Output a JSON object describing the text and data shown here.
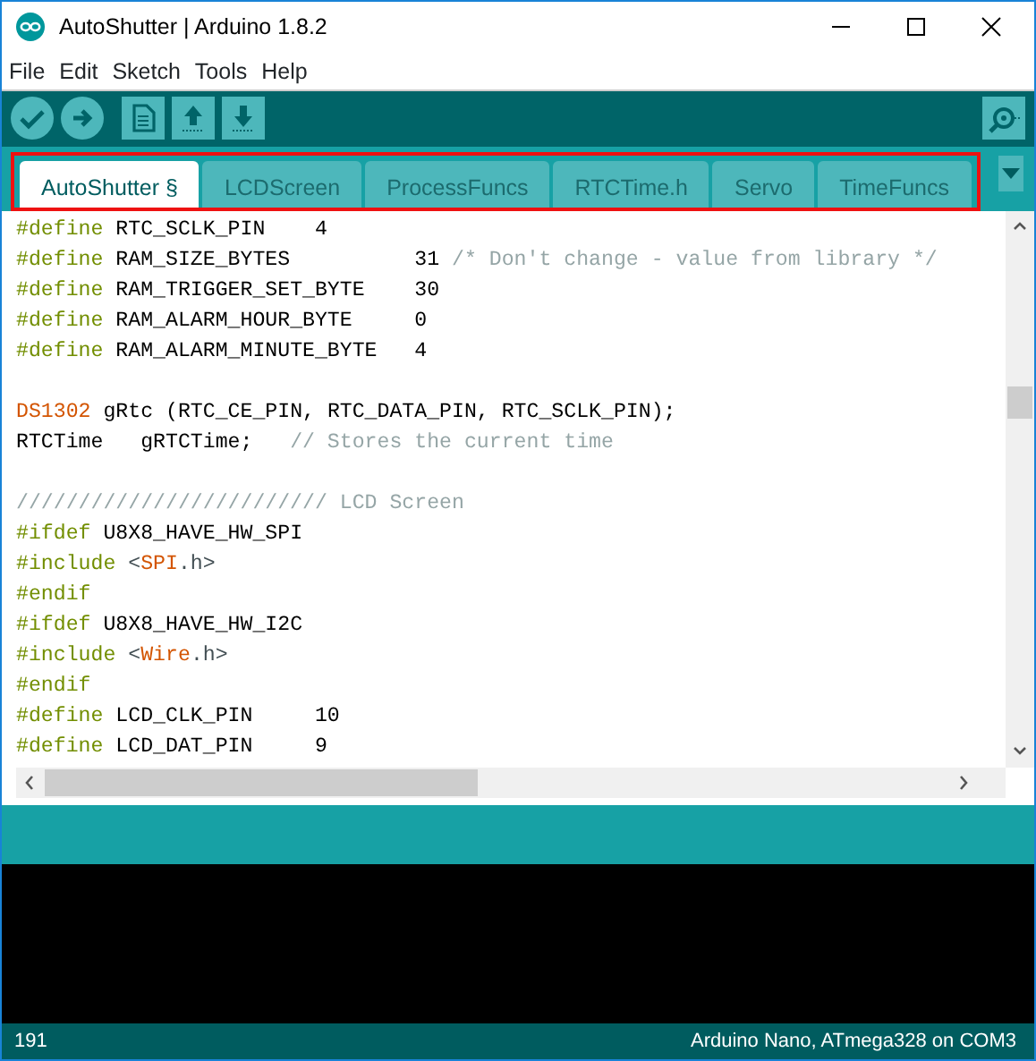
{
  "window": {
    "title": "AutoShutter | Arduino 1.8.2"
  },
  "menu": [
    {
      "label": "File"
    },
    {
      "label": "Edit"
    },
    {
      "label": "Sketch"
    },
    {
      "label": "Tools"
    },
    {
      "label": "Help"
    }
  ],
  "toolbar": [
    {
      "kind": "verify"
    },
    {
      "kind": "upload"
    },
    {
      "kind": "new"
    },
    {
      "kind": "open"
    },
    {
      "kind": "save"
    }
  ],
  "tabs_highlighted": true,
  "tabs": [
    {
      "label": "AutoShutter §",
      "selected": true
    },
    {
      "label": "LCDScreen",
      "selected": false
    },
    {
      "label": "ProcessFuncs",
      "selected": false
    },
    {
      "label": "RTCTime.h",
      "selected": false
    },
    {
      "label": "Servo",
      "selected": false
    },
    {
      "label": "TimeFuncs",
      "selected": false
    }
  ],
  "code": [
    {
      "kind": "code",
      "tokens": [
        {
          "kind": "directive",
          "text": "#define"
        },
        {
          "kind": "plain",
          "text": " RTC_SCLK_PIN    4"
        }
      ]
    },
    {
      "kind": "code",
      "tokens": [
        {
          "kind": "directive",
          "text": "#define"
        },
        {
          "kind": "plain",
          "text": " RAM_SIZE_BYTES          31 "
        },
        {
          "kind": "comment",
          "text": "/* Don't change - value from library */"
        }
      ]
    },
    {
      "kind": "code",
      "tokens": [
        {
          "kind": "directive",
          "text": "#define"
        },
        {
          "kind": "plain",
          "text": " RAM_TRIGGER_SET_BYTE    30"
        }
      ]
    },
    {
      "kind": "code",
      "tokens": [
        {
          "kind": "directive",
          "text": "#define"
        },
        {
          "kind": "plain",
          "text": " RAM_ALARM_HOUR_BYTE     0"
        }
      ]
    },
    {
      "kind": "code",
      "tokens": [
        {
          "kind": "directive",
          "text": "#define"
        },
        {
          "kind": "plain",
          "text": " RAM_ALARM_MINUTE_BYTE   4"
        }
      ]
    },
    {
      "kind": "blank"
    },
    {
      "kind": "code",
      "tokens": [
        {
          "kind": "type",
          "text": "DS1302"
        },
        {
          "kind": "plain",
          "text": " gRtc (RTC_CE_PIN, RTC_DATA_PIN, RTC_SCLK_PIN);"
        }
      ]
    },
    {
      "kind": "code",
      "tokens": [
        {
          "kind": "plain",
          "text": "RTCTime   gRTCTime;   "
        },
        {
          "kind": "comment",
          "text": "// Stores the current time"
        }
      ]
    },
    {
      "kind": "blank"
    },
    {
      "kind": "code",
      "tokens": [
        {
          "kind": "comment",
          "text": "///////////////////////// LCD Screen"
        }
      ]
    },
    {
      "kind": "code",
      "tokens": [
        {
          "kind": "directive",
          "text": "#ifdef"
        },
        {
          "kind": "plain",
          "text": " U8X8_HAVE_HW_SPI"
        }
      ]
    },
    {
      "kind": "code",
      "tokens": [
        {
          "kind": "directive",
          "text": "#include"
        },
        {
          "kind": "punct",
          "text": " <"
        },
        {
          "kind": "type",
          "text": "SPI"
        },
        {
          "kind": "punct",
          "text": ".h>"
        }
      ]
    },
    {
      "kind": "code",
      "tokens": [
        {
          "kind": "directive",
          "text": "#endif"
        }
      ]
    },
    {
      "kind": "code",
      "tokens": [
        {
          "kind": "directive",
          "text": "#ifdef"
        },
        {
          "kind": "plain",
          "text": " U8X8_HAVE_HW_I2C"
        }
      ]
    },
    {
      "kind": "code",
      "tokens": [
        {
          "kind": "directive",
          "text": "#include"
        },
        {
          "kind": "punct",
          "text": " <"
        },
        {
          "kind": "type",
          "text": "Wire"
        },
        {
          "kind": "punct",
          "text": ".h>"
        }
      ]
    },
    {
      "kind": "code",
      "tokens": [
        {
          "kind": "directive",
          "text": "#endif"
        }
      ]
    },
    {
      "kind": "code",
      "tokens": [
        {
          "kind": "directive",
          "text": "#define"
        },
        {
          "kind": "plain",
          "text": " LCD_CLK_PIN     10"
        }
      ]
    },
    {
      "kind": "code",
      "tokens": [
        {
          "kind": "directive",
          "text": "#define"
        },
        {
          "kind": "plain",
          "text": " LCD_DAT_PIN     9"
        }
      ]
    }
  ],
  "status_bar": {
    "line": "191",
    "board": "Arduino Nano, ATmega328 on COM3"
  }
}
